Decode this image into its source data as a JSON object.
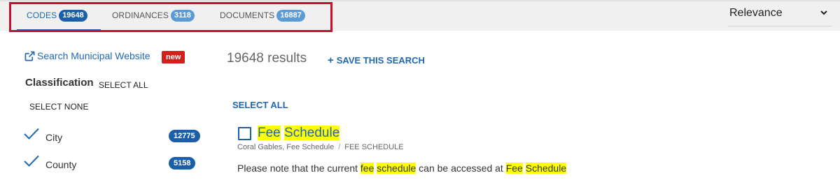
{
  "tabs": [
    {
      "label": "CODES",
      "count": "19648",
      "active": true
    },
    {
      "label": "ORDINANCES",
      "count": "3118",
      "active": false
    },
    {
      "label": "DOCUMENTS",
      "count": "16887",
      "active": false
    }
  ],
  "sort": {
    "selected": "Relevance"
  },
  "sidebar": {
    "municipal_link": "Search Municipal Website",
    "new_badge": "new",
    "classification_title": "Classification",
    "select_all": "SELECT ALL",
    "select_none": "SELECT NONE",
    "facets": [
      {
        "label": "City",
        "count": "12775",
        "checked": true
      },
      {
        "label": "County",
        "count": "5158",
        "checked": true
      }
    ]
  },
  "main": {
    "results_count": "19648 results",
    "save_search": "SAVE THIS SEARCH",
    "select_all": "SELECT ALL",
    "result": {
      "title_words": [
        "Fee",
        "Schedule"
      ],
      "meta_path": "Coral Gables, Fee Schedule",
      "meta_separator": "/",
      "meta_section": "FEE SCHEDULE",
      "snippet_prefix": "Please note that the current ",
      "snippet_hl1": "fee",
      "snippet_hl2": "schedule",
      "snippet_middle": " can be accessed at ",
      "snippet_hl3": "Fee",
      "snippet_hl4": "Schedule"
    }
  },
  "colors": {
    "accent_blue": "#1a5fa8",
    "link_blue": "#1f68b3",
    "inactive_badge": "#5b9bd5",
    "highlight": "#ffff00",
    "new_badge": "#d0211c",
    "frame_red": "#c8102e"
  },
  "icons": {
    "external_link": "external-link-icon",
    "sort_chevron": "chevron-down-icon",
    "facet_check": "checkmark-icon",
    "save_plus": "plus-icon"
  }
}
